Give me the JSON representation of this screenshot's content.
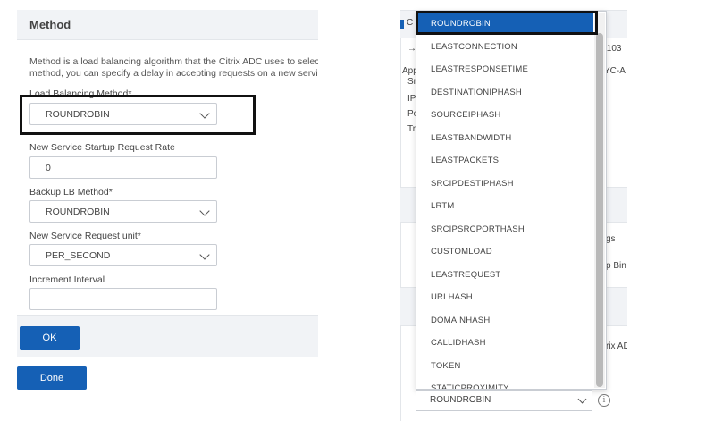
{
  "method_section": {
    "title": "Method",
    "description_line1": "Method is a load balancing algorithm that the Citrix ADC uses to select",
    "description_line2": "method, you can specify a delay in accepting requests on a new service",
    "lb_method_label": "Load Balancing Method*",
    "lb_method_value": "ROUNDROBIN",
    "startup_rate_label": "New Service Startup Request Rate",
    "startup_rate_value": "0",
    "backup_lb_label": "Backup LB Method*",
    "backup_lb_value": "ROUNDROBIN",
    "request_unit_label": "New Service Request unit*",
    "request_unit_value": "PER_SECOND",
    "increment_label": "Increment Interval",
    "increment_value": "",
    "ok_label": "OK",
    "done_label": "Done"
  },
  "background_panel": {
    "row1": "C",
    "row2_right": ".103",
    "row2_arrow": "→",
    "row3_left": "App",
    "row3_right": "YC-A",
    "side_lines": [
      "IP",
      "Po",
      "Tr"
    ],
    "side_top": "Sr",
    "gs_text": "gs",
    "bin_text": "p Bin",
    "adc_text": "rix AD"
  },
  "dropdown": {
    "options": [
      "ROUNDROBIN",
      "LEASTCONNECTION",
      "LEASTRESPONSETIME",
      "DESTINATIONIPHASH",
      "SOURCEIPHASH",
      "LEASTBANDWIDTH",
      "LEASTPACKETS",
      "SRCIPDESTIPHASH",
      "LRTM",
      "SRCIPSRCPORTHASH",
      "CUSTOMLOAD",
      "LEASTREQUEST",
      "URLHASH",
      "DOMAINHASH",
      "CALLIDHASH",
      "TOKEN",
      "STATICPROXIMITY"
    ],
    "selected": "ROUNDROBIN",
    "current_value": "ROUNDROBIN",
    "info_glyph": "i"
  },
  "colors": {
    "accent": "#1560b5",
    "panel_bg": "#f1f3f6"
  }
}
